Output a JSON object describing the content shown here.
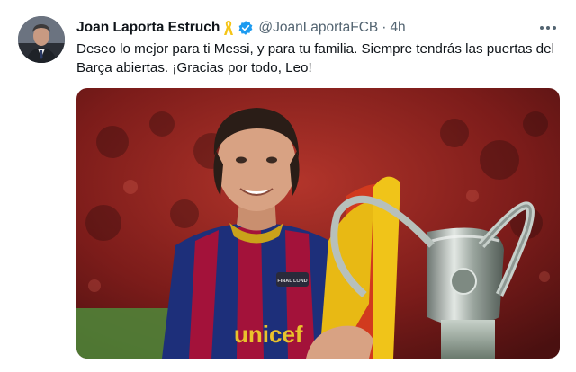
{
  "tweet": {
    "author": {
      "display_name": "Joan Laporta Estruch",
      "handle": "@JoanLaportaFCB",
      "ribbon_icon": "yellow-ribbon-icon",
      "verified_icon": "verified-badge-icon"
    },
    "separator": "·",
    "time": "4h",
    "text": "Deseo lo mejor para ti Messi, y para tu familia. Siempre tendrás las puertas del Barça abiertas. ¡Gracias por todo, Leo!",
    "more_icon": "more-options-icon",
    "media": {
      "jersey_sponsor_text": "unicef",
      "final_badge_text": "FINAL LOND",
      "description_icon": "trophy-celebration-photo"
    }
  },
  "colors": {
    "text_primary": "#0f1419",
    "text_secondary": "#536471",
    "verified_blue": "#1d9bf0",
    "ribbon_yellow": "#f5c518"
  }
}
